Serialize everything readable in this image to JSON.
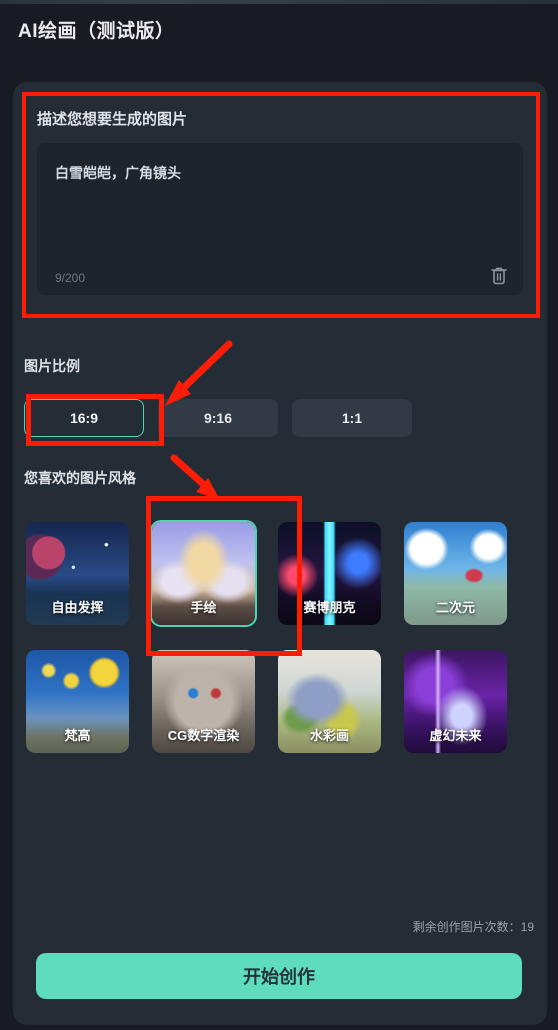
{
  "app": {
    "title": "AI绘画（测试版）"
  },
  "prompt": {
    "label": "描述您想要生成的图片",
    "value": "白雪皑皑，广角镜头",
    "placeholder": "描述您想要生成的图片",
    "counter": "9/200",
    "clear_icon": "trash-icon"
  },
  "ratio": {
    "label": "图片比例",
    "options": [
      {
        "label": "16:9",
        "selected": true
      },
      {
        "label": "9:16",
        "selected": false
      },
      {
        "label": "1:1",
        "selected": false
      }
    ]
  },
  "style": {
    "label": "您喜欢的图片风格",
    "options": [
      {
        "label": "自由发挥",
        "selected": false,
        "thumb": "th-space"
      },
      {
        "label": "手绘",
        "selected": true,
        "thumb": "th-castle"
      },
      {
        "label": "赛博朋克",
        "selected": false,
        "thumb": "th-cyber"
      },
      {
        "label": "二次元",
        "selected": false,
        "thumb": "th-anime"
      },
      {
        "label": "梵高",
        "selected": false,
        "thumb": "th-vangogh"
      },
      {
        "label": "CG数字渲染",
        "selected": false,
        "thumb": "th-cg"
      },
      {
        "label": "水彩画",
        "selected": false,
        "thumb": "th-water"
      },
      {
        "label": "虚幻未来",
        "selected": false,
        "thumb": "th-future"
      }
    ]
  },
  "footer": {
    "remaining": "剩余创作图片次数：19",
    "create_label": "开始创作"
  },
  "colors": {
    "page_bg": "#181c22",
    "panel_bg": "#242c36",
    "field_bg": "#1d242c",
    "accent": "#5fdcbc",
    "accent_border": "#4bd6b0",
    "annotation": "#fc1d07",
    "text_primary": "#e8eaed",
    "text_muted": "#6b7480"
  }
}
